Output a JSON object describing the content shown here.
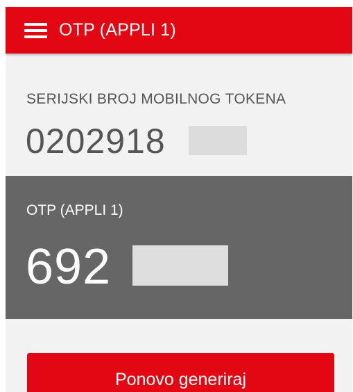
{
  "app_bar": {
    "menu_icon": "hamburger-menu-icon",
    "title": "OTP (APPLI 1)",
    "color": "#e30613"
  },
  "serial": {
    "label": "SERIJSKI BROJ MOBILNOG TOKENA",
    "value": "0202918"
  },
  "otp": {
    "label": "OTP (APPLI 1)",
    "value": "692"
  },
  "actions": {
    "regenerate_label": "Ponovo generiraj"
  }
}
